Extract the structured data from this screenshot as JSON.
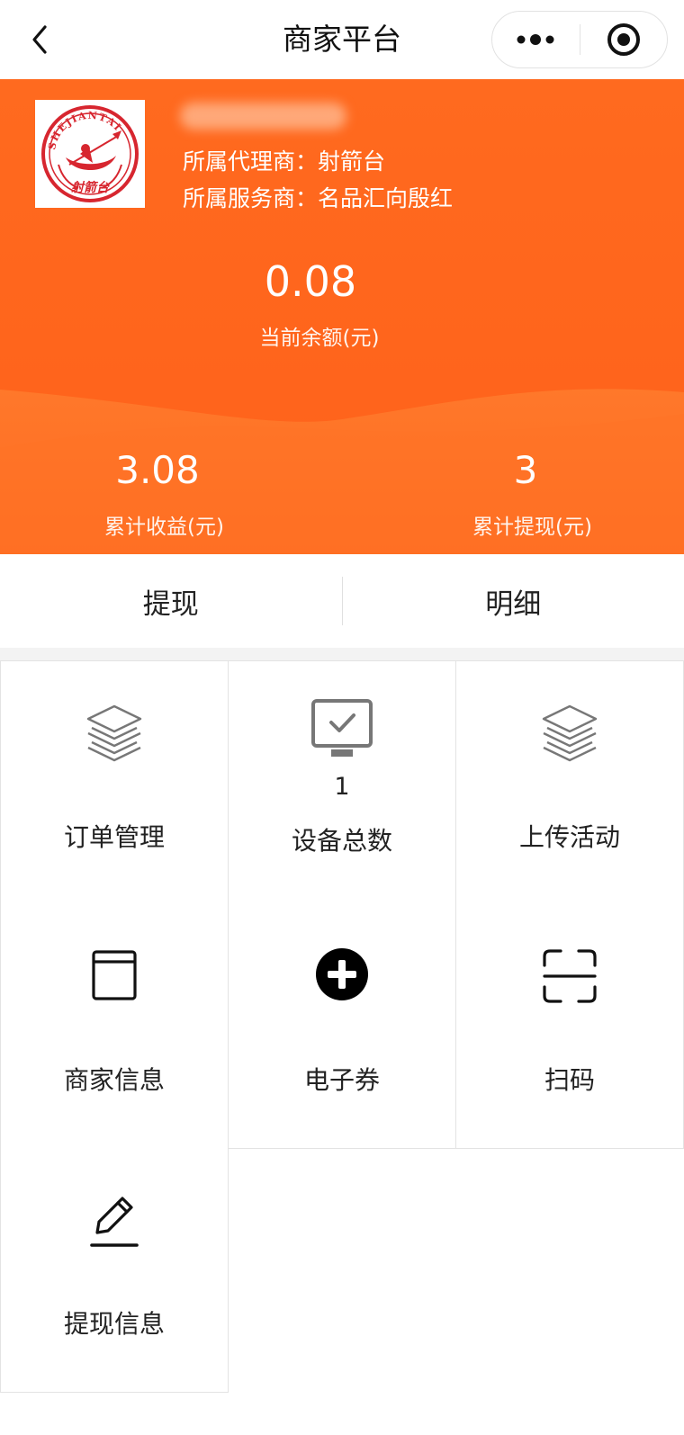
{
  "nav": {
    "title": "商家平台"
  },
  "merchant": {
    "logo_text_top": "SHEJIANTAI",
    "logo_text_bottom": "射箭台",
    "agent_line": "所属代理商：射箭台",
    "service_line": "所属服务商：名品汇向殷红"
  },
  "balance": {
    "value": "0.08",
    "label": "当前余额(元)"
  },
  "stats": [
    {
      "value": "3.08",
      "label": "累计收益(元)"
    },
    {
      "value": "3",
      "label": "累计提现(元)"
    }
  ],
  "actions": {
    "withdraw": "提现",
    "details": "明细"
  },
  "grid": [
    {
      "label": "订单管理",
      "icon": "layers-icon"
    },
    {
      "label": "设备总数",
      "icon": "monitor-check-icon",
      "count": "1"
    },
    {
      "label": "上传活动",
      "icon": "layers-icon"
    },
    {
      "label": "商家信息",
      "icon": "document-icon"
    },
    {
      "label": "电子券",
      "icon": "plus-circle-icon"
    },
    {
      "label": "扫码",
      "icon": "scan-icon"
    },
    {
      "label": "提现信息",
      "icon": "edit-pen-icon"
    }
  ],
  "colors": {
    "brand_orange": "#ff621b",
    "logo_red": "#d7262f"
  }
}
